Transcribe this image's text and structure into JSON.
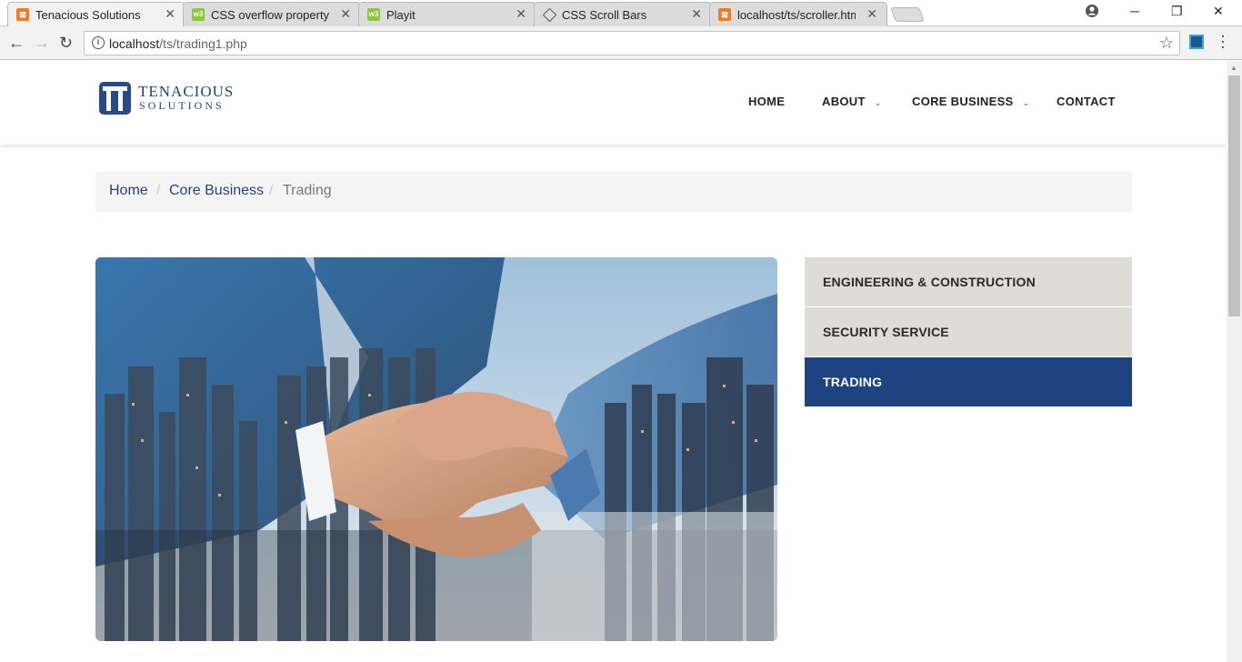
{
  "browser": {
    "tabs": [
      {
        "title": "Tenacious Solutions",
        "icon": "xampp-icon",
        "active": true
      },
      {
        "title": "CSS overflow property",
        "icon": "w3schools-icon",
        "active": false
      },
      {
        "title": "Playit",
        "icon": "w3schools-icon",
        "active": false
      },
      {
        "title": "CSS Scroll Bars",
        "icon": "codepen-icon",
        "active": false
      },
      {
        "title": "localhost/ts/scroller.html",
        "icon": "xampp-icon",
        "active": false
      }
    ],
    "address": {
      "host": "localhost",
      "path": "/ts/trading1.php"
    }
  },
  "site": {
    "logo": {
      "name": "TENACIOUS",
      "sub": "SOLUTIONS"
    },
    "nav": [
      {
        "label": "HOME",
        "has_dropdown": false
      },
      {
        "label": "ABOUT",
        "has_dropdown": true
      },
      {
        "label": "CORE BUSINESS",
        "has_dropdown": true
      },
      {
        "label": "CONTACT",
        "has_dropdown": false
      }
    ],
    "breadcrumb": [
      "Home",
      "Core Business",
      "Trading"
    ],
    "hero_image": "handshake-over-city-skyline",
    "side_menu": [
      {
        "label": "ENGINEERING & CONSTRUCTION",
        "active": false
      },
      {
        "label": "SECURITY SERVICE",
        "active": false
      },
      {
        "label": "TRADING",
        "active": true
      }
    ]
  },
  "colors": {
    "brand_navy": "#1f4283",
    "menu_inactive": "#dedcd6",
    "breadcrumb_link": "#2a3f73"
  }
}
